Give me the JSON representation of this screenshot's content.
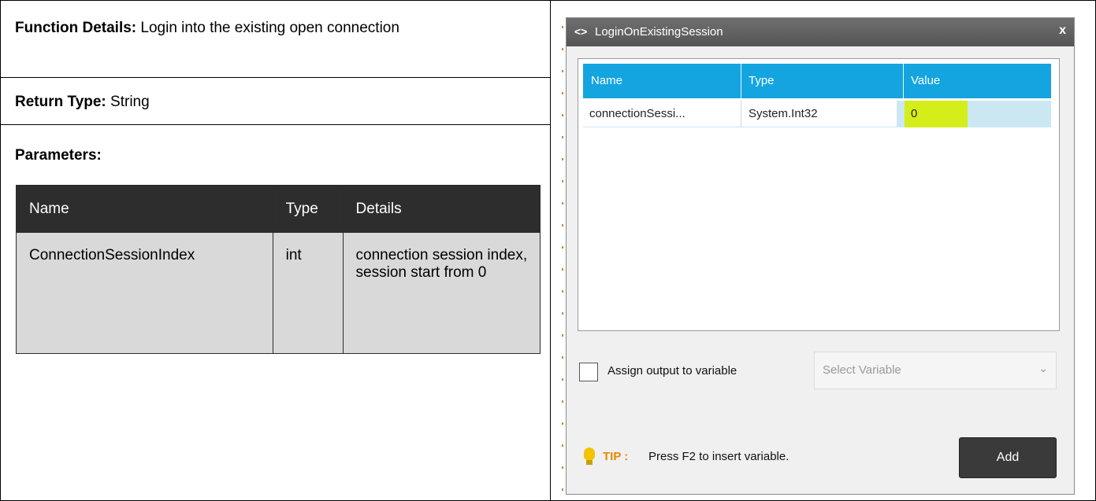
{
  "function_details": {
    "label": "Function Details:",
    "text": " Login into the existing open connection"
  },
  "return_type": {
    "label": "Return Type:",
    "text": " String"
  },
  "parameters": {
    "label": "Parameters:",
    "headers": [
      "Name",
      "Type",
      "Details"
    ],
    "rows": [
      {
        "name": "ConnectionSessionIndex",
        "type": "int",
        "details": "connection session index, session start from 0"
      }
    ]
  },
  "dialog": {
    "title": "LoginOnExistingSession",
    "title_icon": "code-icon",
    "close": "x",
    "grid": {
      "headers": [
        "Name",
        "Type",
        "Value"
      ],
      "rows": [
        {
          "name": "connectionSessi...",
          "type": "System.Int32",
          "value": "0"
        }
      ],
      "header_color": "#14a4e0",
      "highlight_color": "#d4ee1a"
    },
    "assign_output_label": "Assign output to variable",
    "assign_output_checked": false,
    "select_variable": {
      "value": "Select Variable"
    },
    "tip": {
      "label": "TIP :",
      "text": "Press F2 to insert variable.",
      "icon": "lightbulb-icon"
    },
    "add_button": "Add"
  }
}
